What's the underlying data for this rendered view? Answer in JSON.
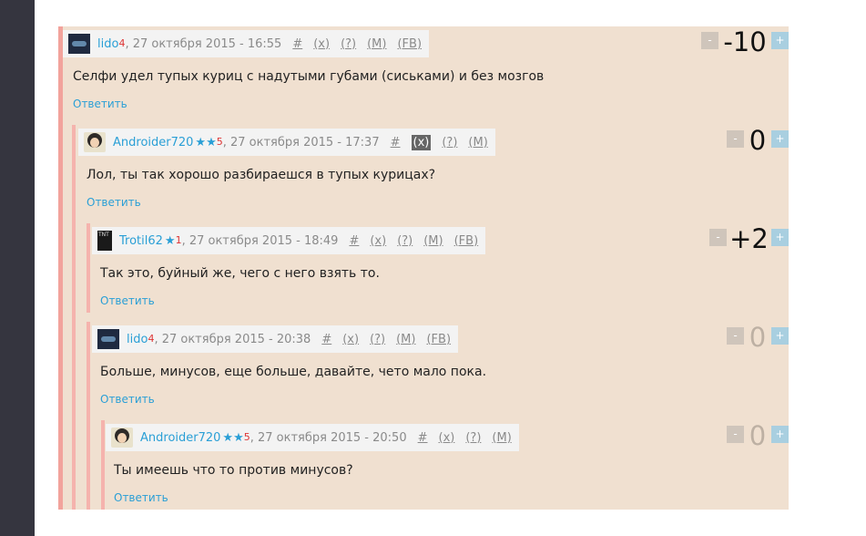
{
  "reply_label": "Ответить",
  "colors": {
    "comment_bg": "#f0e0d0",
    "thread_line": "#f2a39c",
    "link": "#2a9fd6",
    "rank": "#dd3333",
    "sidebar": "#35353f"
  },
  "comments": [
    {
      "user": "lido",
      "rank": "4",
      "stars": "",
      "avatar_icon": "space-avatar",
      "date": ", 27 октября 2015 - 16:55",
      "actions": [
        "#",
        "(x)",
        "(?)",
        "(M)",
        "(FB)"
      ],
      "text": "Селфи удел тупых куриц с надутыми губами (сиськами) и без мозгов",
      "score": "-10",
      "vote_minus": "-",
      "vote_plus": "+"
    },
    {
      "user": "Androider720",
      "rank": "5",
      "stars": "★★",
      "avatar_icon": "girl-avatar",
      "date": ", 27 октября 2015 - 17:37",
      "actions": [
        "#",
        "(x)",
        "(?)",
        "(M)"
      ],
      "text": "Лол, ты так хорошо разбираешся в тупых курицах?",
      "score": "0",
      "vote_minus": "-",
      "vote_plus": "+"
    },
    {
      "user": "Trotil62",
      "rank": "1",
      "stars": "★",
      "avatar_icon": "tnt-avatar",
      "date": ", 27 октября 2015 - 18:49",
      "actions": [
        "#",
        "(x)",
        "(?)",
        "(M)",
        "(FB)"
      ],
      "text": "Так это, буйный же, чего с него взять то.",
      "score": "+2",
      "vote_minus": "-",
      "vote_plus": "+"
    },
    {
      "user": "lido",
      "rank": "4",
      "stars": "",
      "avatar_icon": "space-avatar",
      "date": ", 27 октября 2015 - 20:38",
      "actions": [
        "#",
        "(x)",
        "(?)",
        "(M)",
        "(FB)"
      ],
      "text": "Больше, минусов, еще больше, давайте, чето мало пока.",
      "score": "0",
      "vote_minus": "-",
      "vote_plus": "+"
    },
    {
      "user": "Androider720",
      "rank": "5",
      "stars": "★★",
      "avatar_icon": "girl-avatar",
      "date": ", 27 октября 2015 - 20:50",
      "actions": [
        "#",
        "(x)",
        "(?)",
        "(M)"
      ],
      "text": "Ты имеешь что то против минусов?",
      "score": "0",
      "vote_minus": "-",
      "vote_plus": "+"
    }
  ]
}
